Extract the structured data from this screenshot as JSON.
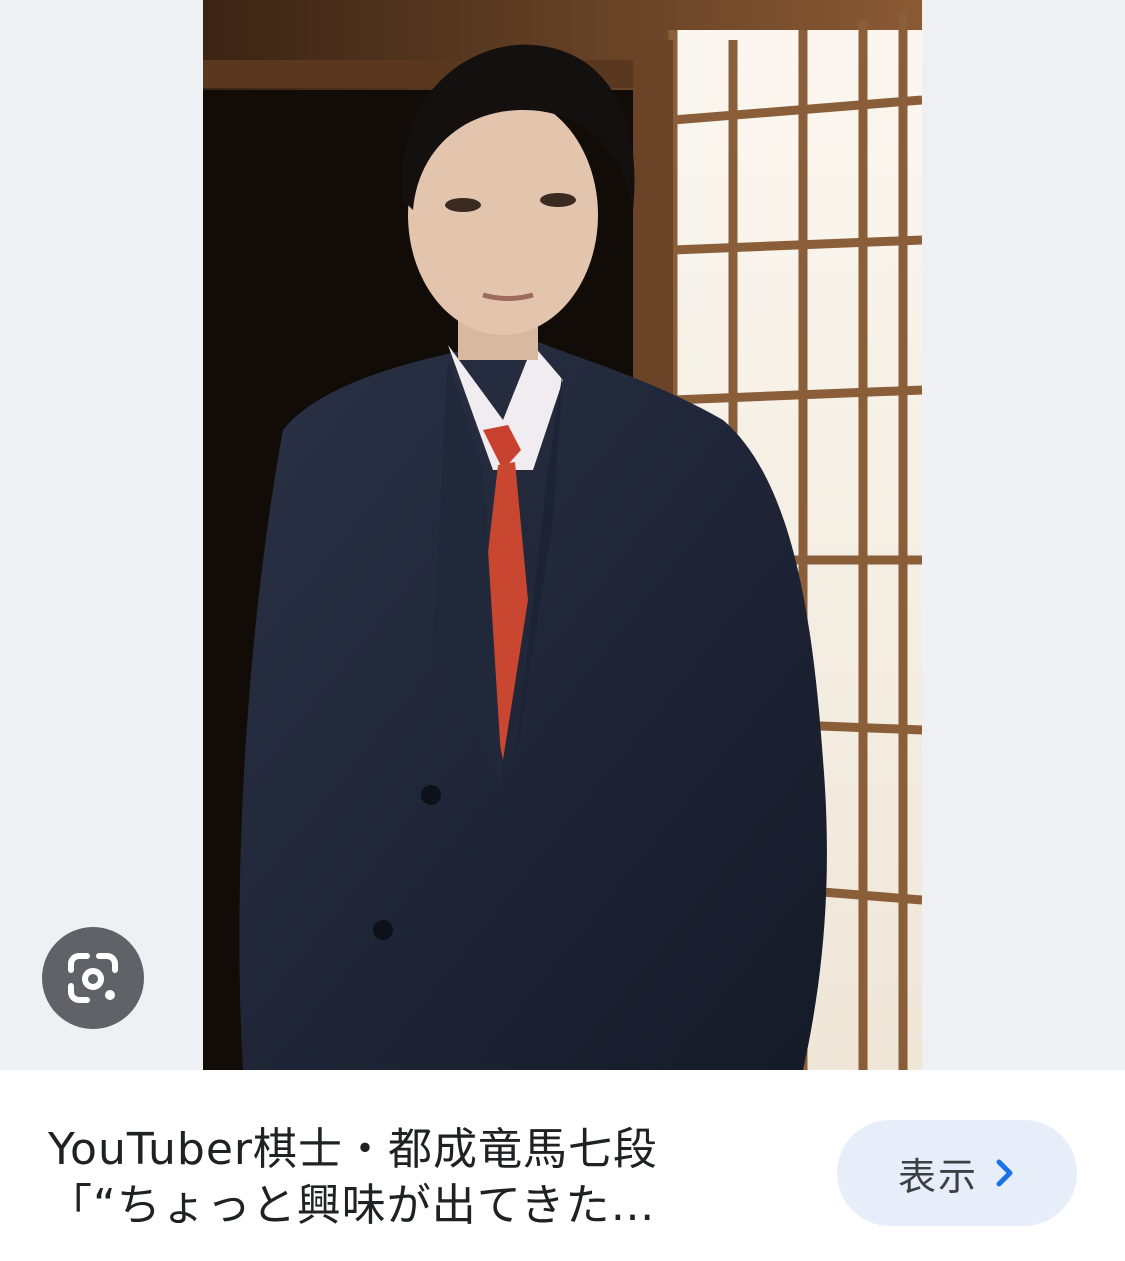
{
  "caption": {
    "title_line1": "YouTuber棋士・都成竜馬七段",
    "title_line2": "「“ちょっと興味が出てきた…"
  },
  "actions": {
    "show_label": "表示"
  },
  "icons": {
    "lens": "google-lens-icon",
    "chevron": "chevron-right-icon"
  },
  "colors": {
    "show_button_bg": "#e8eef9",
    "chevron": "#1a73e8",
    "lens_button_bg": "#5f6266"
  }
}
